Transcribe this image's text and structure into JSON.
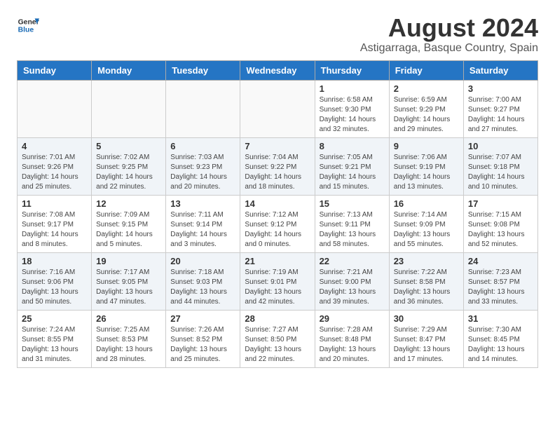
{
  "header": {
    "logo_general": "General",
    "logo_blue": "Blue",
    "month_year": "August 2024",
    "location": "Astigarraga, Basque Country, Spain"
  },
  "days_of_week": [
    "Sunday",
    "Monday",
    "Tuesday",
    "Wednesday",
    "Thursday",
    "Friday",
    "Saturday"
  ],
  "weeks": [
    [
      {
        "day": "",
        "info": ""
      },
      {
        "day": "",
        "info": ""
      },
      {
        "day": "",
        "info": ""
      },
      {
        "day": "",
        "info": ""
      },
      {
        "day": "1",
        "info": "Sunrise: 6:58 AM\nSunset: 9:30 PM\nDaylight: 14 hours\nand 32 minutes."
      },
      {
        "day": "2",
        "info": "Sunrise: 6:59 AM\nSunset: 9:29 PM\nDaylight: 14 hours\nand 29 minutes."
      },
      {
        "day": "3",
        "info": "Sunrise: 7:00 AM\nSunset: 9:27 PM\nDaylight: 14 hours\nand 27 minutes."
      }
    ],
    [
      {
        "day": "4",
        "info": "Sunrise: 7:01 AM\nSunset: 9:26 PM\nDaylight: 14 hours\nand 25 minutes."
      },
      {
        "day": "5",
        "info": "Sunrise: 7:02 AM\nSunset: 9:25 PM\nDaylight: 14 hours\nand 22 minutes."
      },
      {
        "day": "6",
        "info": "Sunrise: 7:03 AM\nSunset: 9:23 PM\nDaylight: 14 hours\nand 20 minutes."
      },
      {
        "day": "7",
        "info": "Sunrise: 7:04 AM\nSunset: 9:22 PM\nDaylight: 14 hours\nand 18 minutes."
      },
      {
        "day": "8",
        "info": "Sunrise: 7:05 AM\nSunset: 9:21 PM\nDaylight: 14 hours\nand 15 minutes."
      },
      {
        "day": "9",
        "info": "Sunrise: 7:06 AM\nSunset: 9:19 PM\nDaylight: 14 hours\nand 13 minutes."
      },
      {
        "day": "10",
        "info": "Sunrise: 7:07 AM\nSunset: 9:18 PM\nDaylight: 14 hours\nand 10 minutes."
      }
    ],
    [
      {
        "day": "11",
        "info": "Sunrise: 7:08 AM\nSunset: 9:17 PM\nDaylight: 14 hours\nand 8 minutes."
      },
      {
        "day": "12",
        "info": "Sunrise: 7:09 AM\nSunset: 9:15 PM\nDaylight: 14 hours\nand 5 minutes."
      },
      {
        "day": "13",
        "info": "Sunrise: 7:11 AM\nSunset: 9:14 PM\nDaylight: 14 hours\nand 3 minutes."
      },
      {
        "day": "14",
        "info": "Sunrise: 7:12 AM\nSunset: 9:12 PM\nDaylight: 14 hours\nand 0 minutes."
      },
      {
        "day": "15",
        "info": "Sunrise: 7:13 AM\nSunset: 9:11 PM\nDaylight: 13 hours\nand 58 minutes."
      },
      {
        "day": "16",
        "info": "Sunrise: 7:14 AM\nSunset: 9:09 PM\nDaylight: 13 hours\nand 55 minutes."
      },
      {
        "day": "17",
        "info": "Sunrise: 7:15 AM\nSunset: 9:08 PM\nDaylight: 13 hours\nand 52 minutes."
      }
    ],
    [
      {
        "day": "18",
        "info": "Sunrise: 7:16 AM\nSunset: 9:06 PM\nDaylight: 13 hours\nand 50 minutes."
      },
      {
        "day": "19",
        "info": "Sunrise: 7:17 AM\nSunset: 9:05 PM\nDaylight: 13 hours\nand 47 minutes."
      },
      {
        "day": "20",
        "info": "Sunrise: 7:18 AM\nSunset: 9:03 PM\nDaylight: 13 hours\nand 44 minutes."
      },
      {
        "day": "21",
        "info": "Sunrise: 7:19 AM\nSunset: 9:01 PM\nDaylight: 13 hours\nand 42 minutes."
      },
      {
        "day": "22",
        "info": "Sunrise: 7:21 AM\nSunset: 9:00 PM\nDaylight: 13 hours\nand 39 minutes."
      },
      {
        "day": "23",
        "info": "Sunrise: 7:22 AM\nSunset: 8:58 PM\nDaylight: 13 hours\nand 36 minutes."
      },
      {
        "day": "24",
        "info": "Sunrise: 7:23 AM\nSunset: 8:57 PM\nDaylight: 13 hours\nand 33 minutes."
      }
    ],
    [
      {
        "day": "25",
        "info": "Sunrise: 7:24 AM\nSunset: 8:55 PM\nDaylight: 13 hours\nand 31 minutes."
      },
      {
        "day": "26",
        "info": "Sunrise: 7:25 AM\nSunset: 8:53 PM\nDaylight: 13 hours\nand 28 minutes."
      },
      {
        "day": "27",
        "info": "Sunrise: 7:26 AM\nSunset: 8:52 PM\nDaylight: 13 hours\nand 25 minutes."
      },
      {
        "day": "28",
        "info": "Sunrise: 7:27 AM\nSunset: 8:50 PM\nDaylight: 13 hours\nand 22 minutes."
      },
      {
        "day": "29",
        "info": "Sunrise: 7:28 AM\nSunset: 8:48 PM\nDaylight: 13 hours\nand 20 minutes."
      },
      {
        "day": "30",
        "info": "Sunrise: 7:29 AM\nSunset: 8:47 PM\nDaylight: 13 hours\nand 17 minutes."
      },
      {
        "day": "31",
        "info": "Sunrise: 7:30 AM\nSunset: 8:45 PM\nDaylight: 13 hours\nand 14 minutes."
      }
    ]
  ]
}
